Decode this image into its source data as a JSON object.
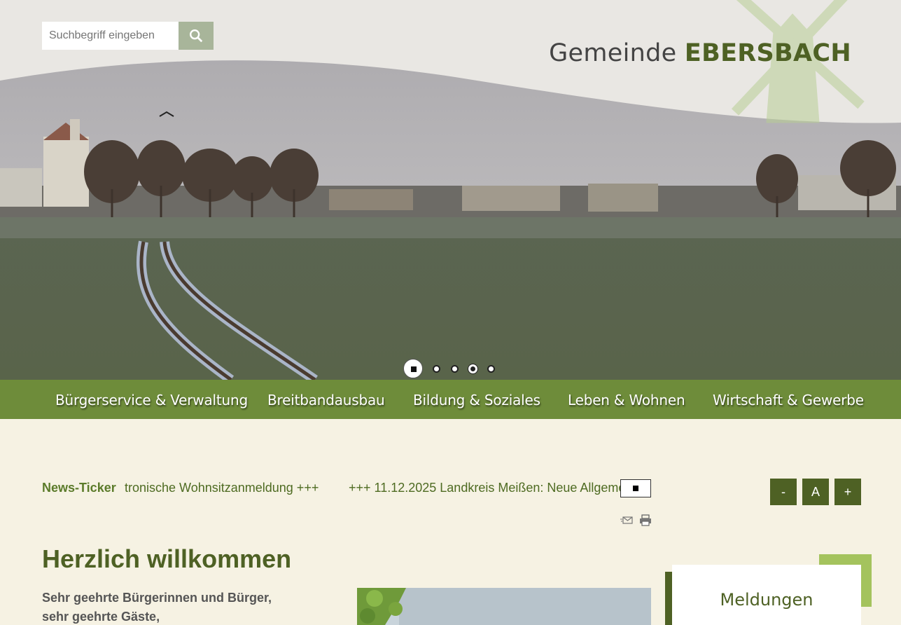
{
  "search": {
    "placeholder": "Suchbegriff eingeben",
    "icon": "search-icon"
  },
  "brand": {
    "prefix": "Gemeinde",
    "name": "EBERSBACH"
  },
  "slider": {
    "slide_count": 5,
    "active_index": 0
  },
  "nav": {
    "items": [
      "Bürgerservice & Verwaltung",
      "Breitbandausbau",
      "Bildung & Soziales",
      "Leben & Wohnen",
      "Wirtschaft & Gewerbe"
    ]
  },
  "ticker": {
    "label": "News-Ticker",
    "messages": [
      "tronische Wohnsitzanmeldung +++",
      "+++ 11.12.2025 Landkreis Meißen: Neue Allgemei"
    ]
  },
  "font_controls": {
    "decrease": "-",
    "reset": "A",
    "increase": "+"
  },
  "tools": {
    "mail_icon": "mail-icon",
    "print_icon": "print-icon"
  },
  "main": {
    "heading": "Herzlich willkommen",
    "greeting_line1": "Sehr geehrte Bürgerinnen und Bürger,",
    "greeting_line2": "sehr geehrte Gäste,"
  },
  "sidebar": {
    "news_title": "Meldungen"
  },
  "colors": {
    "brand_green": "#4e6124",
    "nav_green": "#6e8c3a",
    "accent_green": "#a4c35d",
    "background": "#f6f2e3"
  }
}
